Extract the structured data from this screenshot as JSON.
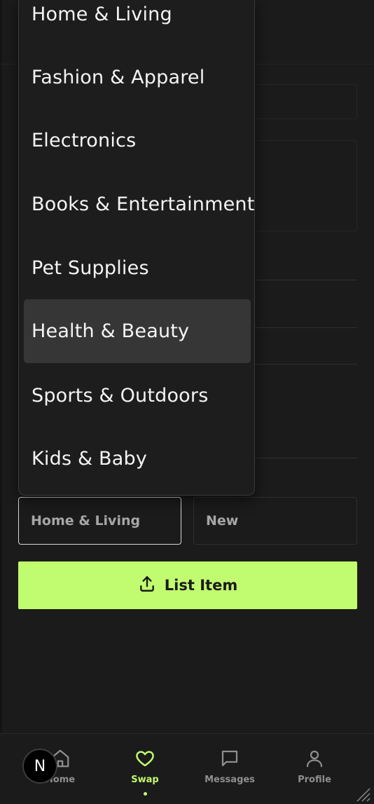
{
  "dropdown": {
    "options": [
      "Home & Living",
      "Fashion & Apparel",
      "Electronics",
      "Books & Entertainment",
      "Pet Supplies",
      "Health & Beauty",
      "Sports & Outdoors",
      "Kids & Baby"
    ],
    "highlighted": "Health & Beauty"
  },
  "form": {
    "category_value": "Home & Living",
    "condition_value": "New",
    "submit_label": "List Item"
  },
  "nav": {
    "items": [
      {
        "label": "Home",
        "icon": "home-icon"
      },
      {
        "label": "Swap",
        "icon": "heart-icon",
        "active": true
      },
      {
        "label": "Messages",
        "icon": "message-icon"
      },
      {
        "label": "Profile",
        "icon": "user-icon"
      }
    ],
    "badge": "N"
  },
  "colors": {
    "accent": "#c1fb6f",
    "background": "#1b1b1b"
  }
}
